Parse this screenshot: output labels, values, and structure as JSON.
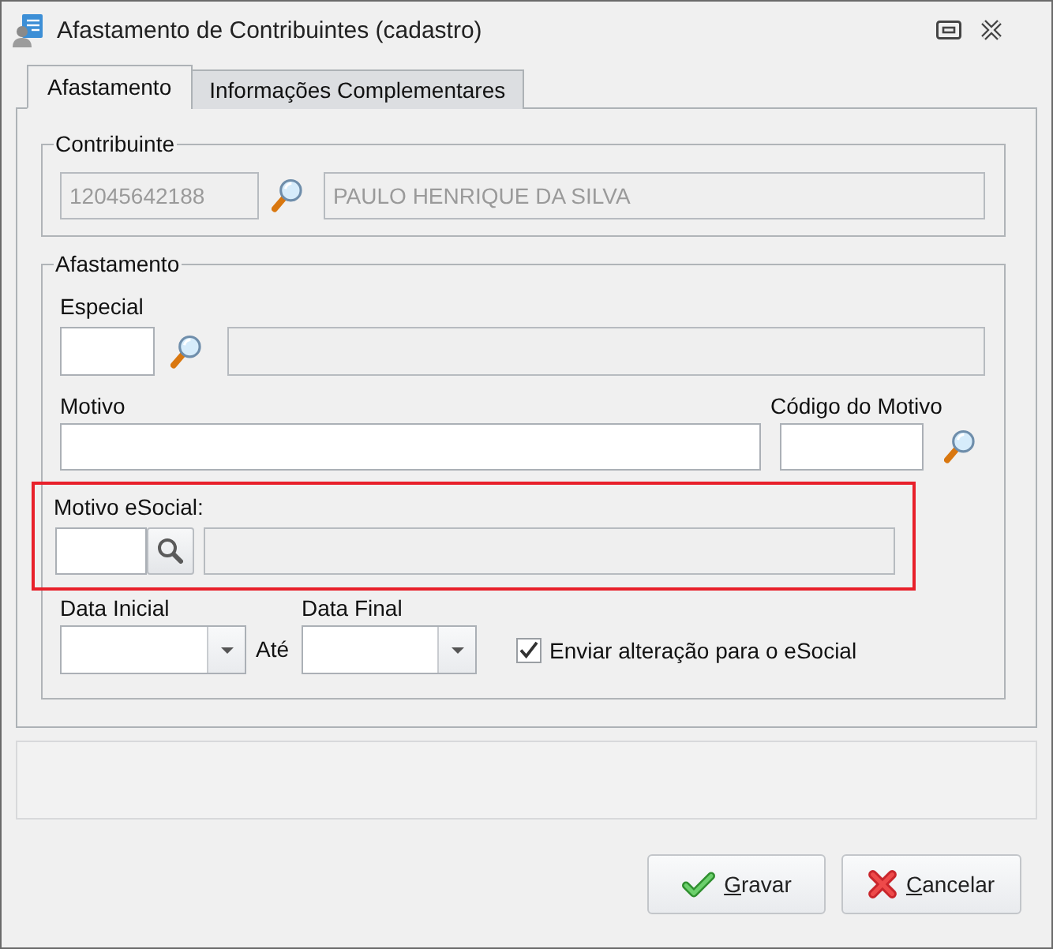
{
  "window": {
    "title": "Afastamento de Contribuintes (cadastro)"
  },
  "tabs": [
    {
      "label": "Afastamento",
      "selected": true
    },
    {
      "label": "Informações Complementares",
      "selected": false
    }
  ],
  "contribuinte": {
    "title": "Contribuinte",
    "code": {
      "value": "12045642188",
      "disabled": true
    },
    "name": {
      "value": "PAULO HENRIQUE DA SILVA",
      "disabled": true
    }
  },
  "afastamento": {
    "title": "Afastamento",
    "especial": {
      "label": "Especial",
      "code": {
        "disabled": false
      },
      "description": {
        "disabled": true
      }
    },
    "motivo": {
      "label": "Motivo",
      "field": {
        "disabled": false
      }
    },
    "codigo_motivo": {
      "label": "Código do Motivo",
      "field": {
        "disabled": false
      }
    },
    "motivo_esocial": {
      "label": "Motivo eSocial:",
      "highlighted": true,
      "code": {
        "disabled": false
      },
      "description": {
        "disabled": true
      }
    },
    "data_inicial": {
      "label": "Data Inicial"
    },
    "ate": "Até",
    "data_final": {
      "label": "Data Final"
    },
    "enviar_esocial": {
      "label": "Enviar alteração para o eSocial",
      "checked": true
    }
  },
  "buttons": [
    {
      "kind": "save",
      "mnemonic": "G",
      "rest": "ravar"
    },
    {
      "kind": "cancel",
      "mnemonic": "C",
      "rest": "ancelar"
    }
  ]
}
